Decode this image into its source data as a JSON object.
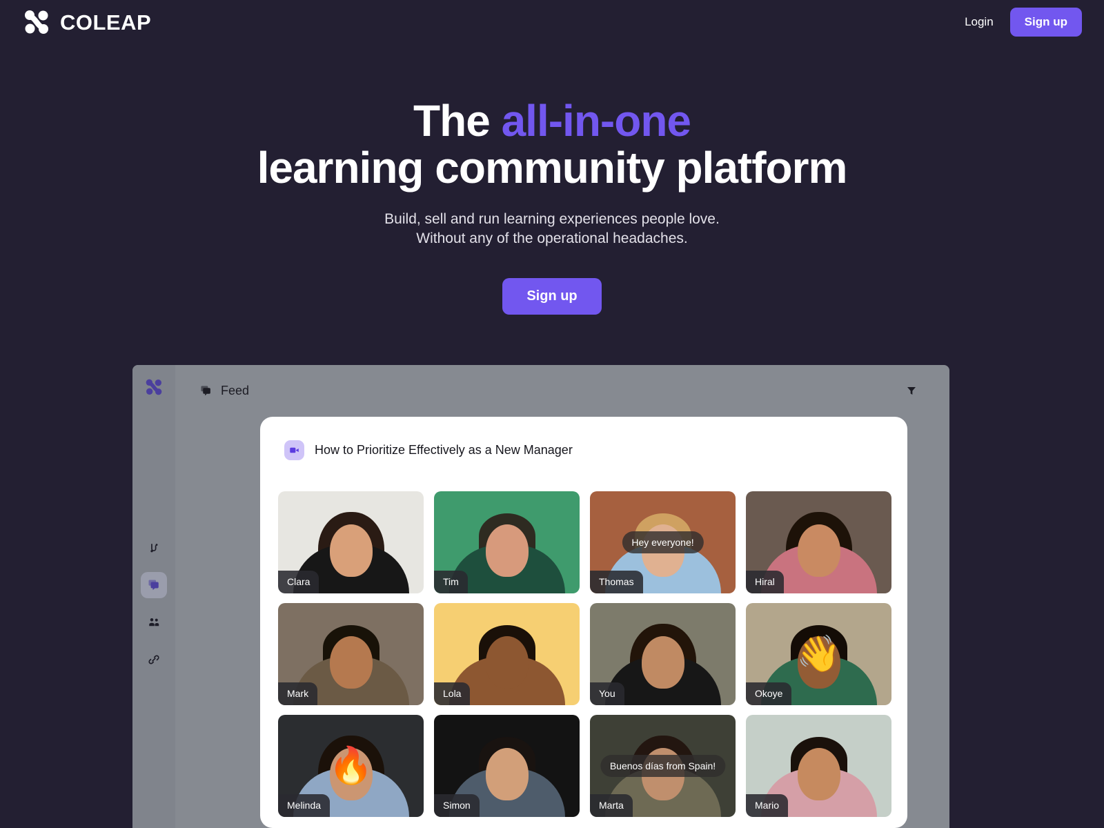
{
  "brand": {
    "name": "COLEAP",
    "logo_icon": "coleap-logo-icon"
  },
  "nav": {
    "login_label": "Login",
    "signup_label": "Sign up"
  },
  "hero": {
    "title_part1": "The ",
    "title_accent": "all-in-one",
    "title_part2": "learning community platform",
    "subtitle_line1": "Build, sell and run learning experiences people love.",
    "subtitle_line2": "Without any of the operational headaches.",
    "cta_label": "Sign up"
  },
  "colors": {
    "background": "#231f32",
    "accent_purple": "#7257ef",
    "mockup_overlay": "#868a91",
    "card_white": "#ffffff",
    "chip_dark": "#2a2a30"
  },
  "app": {
    "sidebar": {
      "logo_icon": "coleap-logo-icon",
      "items": [
        {
          "icon": "path-route-icon",
          "active": false
        },
        {
          "icon": "feed-chat-icon",
          "active": true
        },
        {
          "icon": "people-group-icon",
          "active": false
        },
        {
          "icon": "link-chain-icon",
          "active": false
        }
      ]
    },
    "topbar": {
      "feed_icon": "feed-chat-icon",
      "feed_label": "Feed",
      "filter_icon": "filter-funnel-icon"
    },
    "card": {
      "icon": "video-camera-icon",
      "title": "How to Prioritize Effectively as a New Manager",
      "participants": [
        {
          "name": "Clara",
          "bg": "#e7e6e1",
          "skin": "#d9a079",
          "hair": "#2a1b14",
          "shirt": "#171717",
          "hair_style": "long",
          "bubble": null,
          "emoji": null
        },
        {
          "name": "Tim",
          "bg": "#3f9b6d",
          "skin": "#d79a7c",
          "hair": "#2e2b21",
          "shirt": "#1e4f3d",
          "hair_style": "short",
          "bubble": null,
          "emoji": null
        },
        {
          "name": "Thomas",
          "bg": "#a6603f",
          "skin": "#e0b191",
          "hair": "#cfa161",
          "shirt": "#9cc0dd",
          "hair_style": "short",
          "bubble": "Hey everyone!",
          "emoji": null
        },
        {
          "name": "Hiral",
          "bg": "#6a5a50",
          "skin": "#c98a62",
          "hair": "#1d1208",
          "shirt": "#c9737f",
          "hair_style": "long",
          "bubble": null,
          "emoji": null
        },
        {
          "name": "Mark",
          "bg": "#7e7062",
          "skin": "#b5794f",
          "hair": "#181208",
          "shirt": "#6b5a45",
          "hair_style": "short",
          "bubble": null,
          "emoji": null
        },
        {
          "name": "Lola",
          "bg": "#f6cf72",
          "skin": "#8d5731",
          "hair": "#1a1008",
          "shirt": "#8d5731",
          "hair_style": "short",
          "bubble": null,
          "emoji": null
        },
        {
          "name": "You",
          "bg": "#7d7b6b",
          "skin": "#c08a63",
          "hair": "#221409",
          "shirt": "#171717",
          "hair_style": "long",
          "bubble": null,
          "emoji": null
        },
        {
          "name": "Okoye",
          "bg": "#b3a68c",
          "skin": "#935c35",
          "hair": "#140c06",
          "shirt": "#2e6b4e",
          "hair_style": "short",
          "bubble": null,
          "emoji": "waving-hand"
        },
        {
          "name": "Melinda",
          "bg": "#2b2d30",
          "skin": "#cb9672",
          "hair": "#1b1109",
          "shirt": "#8fa7c4",
          "hair_style": "long",
          "bubble": null,
          "emoji": "fire"
        },
        {
          "name": "Simon",
          "bg": "#131313",
          "skin": "#d29f79",
          "hair": "#191310",
          "shirt": "#4e5c6b",
          "hair_style": "short",
          "bubble": null,
          "emoji": null
        },
        {
          "name": "Marta",
          "bg": "#3e4036",
          "skin": "#c08f6d",
          "hair": "#231610",
          "shirt": "#6e6a54",
          "hair_style": "long",
          "bubble": "Buenos días from Spain!",
          "emoji": null
        },
        {
          "name": "Mario",
          "bg": "#c5cfc8",
          "skin": "#c68a5f",
          "hair": "#1a110b",
          "shirt": "#d59fa7",
          "hair_style": "short",
          "bubble": null,
          "emoji": null
        }
      ]
    }
  },
  "emoji_glyphs": {
    "waving-hand": "👋",
    "fire": "🔥"
  }
}
